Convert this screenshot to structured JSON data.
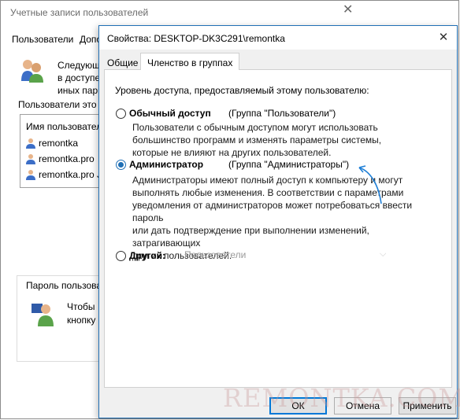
{
  "bg_window": {
    "title": "Учетные записи пользователей",
    "tabs": [
      "Пользователи",
      "Допо"
    ],
    "description": "Следующ\nв доступе\nиных пар",
    "users_label": "Пользователи это",
    "list_header": "Имя пользовател",
    "rows": [
      "remontka",
      "remontka.pro",
      "remontka.pro J"
    ],
    "password_group_label": "Пароль пользова",
    "password_text": "Чтобы\nкнопку"
  },
  "dialog": {
    "title": "Свойства: DESKTOP-DK3C291\\remontka",
    "tabs": {
      "general": "Общие",
      "membership": "Членство в группах"
    },
    "access_title": "Уровень доступа, предоставляемый этому пользователю:",
    "options": {
      "standard": {
        "label": "Обычный доступ",
        "group": "(Группа \"Пользователи\")",
        "description": "Пользователи с обычным доступом могут использовать\nбольшинство программ и изменять параметры системы,\nкоторые не влияют на других пользователей."
      },
      "admin": {
        "label": "Администратор",
        "group": "(Группа \"Администраторы\")",
        "description": "Администраторы имеют полный доступ к компьютеру и могут\nвыполнять любые изменения. В соответствии с параметрами\nуведомления от администраторов может потребоваться ввести пароль\nили дать подтверждение при выполнении изменений, затрагивающих\nдругих пользователей."
      },
      "other": {
        "label": "Другой:",
        "select_value": "Пользователи"
      }
    },
    "selected_option": "admin",
    "buttons": {
      "ok": "ОК",
      "cancel": "Отмена",
      "apply": "Применить"
    }
  },
  "watermark": "REMONTKA.COM",
  "colors": {
    "accent": "#1f6fb5",
    "annotation_arrow": "#1f7fd6"
  },
  "icons": {
    "close": "close-icon",
    "users": "users-icon",
    "user_row": "user-icon",
    "chevron": "chevron-down-icon",
    "arrow": "annotation-arrow"
  }
}
